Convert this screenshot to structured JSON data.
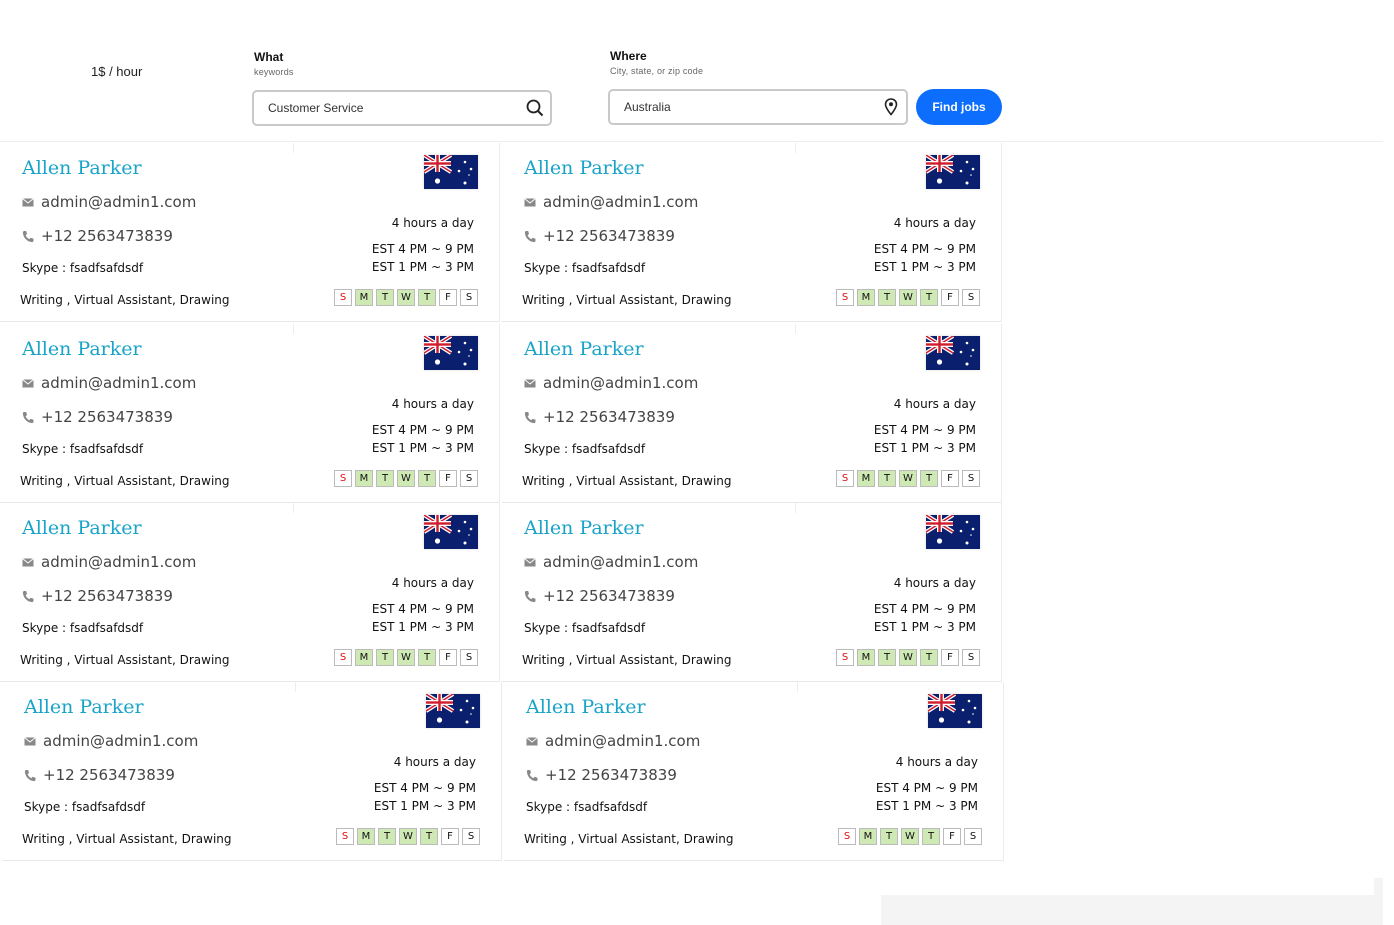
{
  "rate": "1$ / hour",
  "search": {
    "what_label": "What",
    "what_hint": "keywords",
    "what_value": "Customer Service",
    "where_label": "Where",
    "where_hint": "City, state, or zip code",
    "where_value": "Australia",
    "find_button": "Find jobs"
  },
  "accent_color": "#1aa3c9",
  "button_color": "#0d6efd",
  "cards": [
    {
      "name": "Allen Parker",
      "email": "admin@admin1.com",
      "phone": "+12 2563473839",
      "skype": "Skype : fsadfsafdsdf",
      "skills": "Writing , Virtual Assistant, Drawing",
      "hours": "4 hours a day",
      "est1": "EST 4 PM ~ 9 PM",
      "est2": "EST 1 PM ~ 3 PM",
      "country_flag": "australia-flag"
    },
    {
      "name": "Allen Parker",
      "email": "admin@admin1.com",
      "phone": "+12 2563473839",
      "skype": "Skype : fsadfsafdsdf",
      "skills": "Writing , Virtual Assistant, Drawing",
      "hours": "4 hours a day",
      "est1": "EST 4 PM ~ 9 PM",
      "est2": "EST 1 PM ~ 3 PM",
      "country_flag": "australia-flag"
    },
    {
      "name": "Allen Parker",
      "email": "admin@admin1.com",
      "phone": "+12 2563473839",
      "skype": "Skype : fsadfsafdsdf",
      "skills": "Writing , Virtual Assistant, Drawing",
      "hours": "4 hours a day",
      "est1": "EST 4 PM ~ 9 PM",
      "est2": "EST 1 PM ~ 3 PM",
      "country_flag": "australia-flag"
    },
    {
      "name": "Allen Parker",
      "email": "admin@admin1.com",
      "phone": "+12 2563473839",
      "skype": "Skype : fsadfsafdsdf",
      "skills": "Writing , Virtual Assistant, Drawing",
      "hours": "4 hours a day",
      "est1": "EST 4 PM ~ 9 PM",
      "est2": "EST 1 PM ~ 3 PM",
      "country_flag": "australia-flag"
    },
    {
      "name": "Allen Parker",
      "email": "admin@admin1.com",
      "phone": "+12 2563473839",
      "skype": "Skype : fsadfsafdsdf",
      "skills": "Writing , Virtual Assistant, Drawing",
      "hours": "4 hours a day",
      "est1": "EST 4 PM ~ 9 PM",
      "est2": "EST 1 PM ~ 3 PM",
      "country_flag": "australia-flag"
    },
    {
      "name": "Allen Parker",
      "email": "admin@admin1.com",
      "phone": "+12 2563473839",
      "skype": "Skype : fsadfsafdsdf",
      "skills": "Writing , Virtual Assistant, Drawing",
      "hours": "4 hours a day",
      "est1": "EST 4 PM ~ 9 PM",
      "est2": "EST 1 PM ~ 3 PM",
      "country_flag": "australia-flag"
    },
    {
      "name": "Allen Parker",
      "email": "admin@admin1.com",
      "phone": "+12 2563473839",
      "skype": "Skype : fsadfsafdsdf",
      "skills": "Writing , Virtual Assistant, Drawing",
      "hours": "4 hours a day",
      "est1": "EST 4 PM ~ 9 PM",
      "est2": "EST 1 PM ~ 3 PM",
      "country_flag": "australia-flag"
    },
    {
      "name": "Allen Parker",
      "email": "admin@admin1.com",
      "phone": "+12 2563473839",
      "skype": "Skype : fsadfsafdsdf",
      "skills": "Writing , Virtual Assistant, Drawing",
      "hours": "4 hours a day",
      "est1": "EST 4 PM ~ 9 PM",
      "est2": "EST 1 PM ~ 3 PM",
      "country_flag": "australia-flag"
    }
  ],
  "days": [
    {
      "label": "S",
      "active": false,
      "color": "#d11111"
    },
    {
      "label": "M",
      "active": true
    },
    {
      "label": "T",
      "active": true
    },
    {
      "label": "W",
      "active": true
    },
    {
      "label": "T",
      "active": true
    },
    {
      "label": "F",
      "active": false
    },
    {
      "label": "S",
      "active": false
    }
  ]
}
